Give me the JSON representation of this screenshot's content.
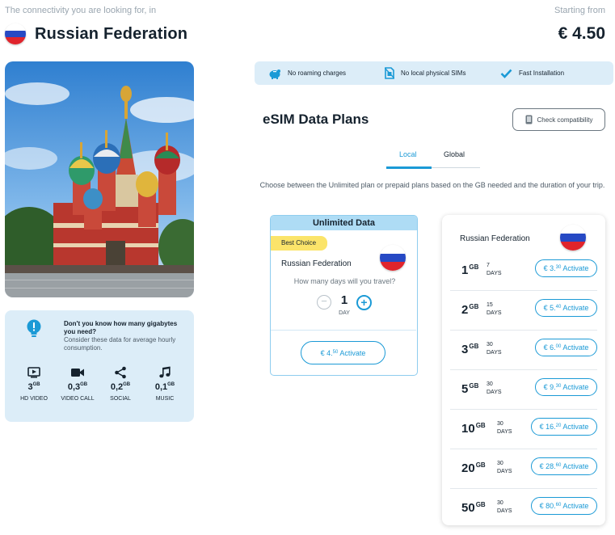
{
  "header": {
    "subtitle": "The connectivity you are looking for, in",
    "country": "Russian Federation",
    "starting_label": "Starting from",
    "starting_price": "€ 4.50"
  },
  "info": {
    "question": "Don't you know how many gigabytes you need?",
    "sub": "Consider these data for average hourly consumption.",
    "usages": [
      {
        "amount": "3",
        "unit": "GB",
        "label": "HD VIDEO",
        "icon": "hd-video-icon"
      },
      {
        "amount": "0,3",
        "unit": "GB",
        "label": "VIDEO CALL",
        "icon": "video-call-icon"
      },
      {
        "amount": "0,2",
        "unit": "GB",
        "label": "SOCIAL",
        "icon": "share-icon"
      },
      {
        "amount": "0,1",
        "unit": "GB",
        "label": "MUSIC",
        "icon": "music-icon"
      }
    ]
  },
  "features": [
    "No roaming charges",
    "No local physical SIMs",
    "Fast Installation"
  ],
  "plans": {
    "title": "eSIM Data Plans",
    "check_button": "Check compatibility",
    "tabs": [
      "Local",
      "Global"
    ],
    "active_tab": "Local",
    "description": "Choose between the Unlimited plan or prepaid plans based on the GB needed and the duration of your trip."
  },
  "unlimited": {
    "header": "Unlimited Data",
    "badge": "Best Choice",
    "country": "Russian Federation",
    "question": "How many days will you travel?",
    "days": "1",
    "day_label": "DAY",
    "price_main": "€ 4.",
    "price_cents": "50",
    "activate": " Activate"
  },
  "prepaid": {
    "country": "Russian Federation",
    "activate": " Activate",
    "items": [
      {
        "gb": "1",
        "unit": "GB",
        "days": "7",
        "days_label": "DAYS",
        "price_main": "€ 3.",
        "price_cents": "30"
      },
      {
        "gb": "2",
        "unit": "GB",
        "days": "15",
        "days_label": "DAYS",
        "price_main": "€ 5.",
        "price_cents": "40"
      },
      {
        "gb": "3",
        "unit": "GB",
        "days": "30",
        "days_label": "DAYS",
        "price_main": "€ 6.",
        "price_cents": "00"
      },
      {
        "gb": "5",
        "unit": "GB",
        "days": "30",
        "days_label": "DAYS",
        "price_main": "€ 9.",
        "price_cents": "30"
      },
      {
        "gb": "10",
        "unit": "GB",
        "days": "30",
        "days_label": "DAYS",
        "price_main": "€ 16.",
        "price_cents": "20"
      },
      {
        "gb": "20",
        "unit": "GB",
        "days": "30",
        "days_label": "DAYS",
        "price_main": "€ 28.",
        "price_cents": "60"
      },
      {
        "gb": "50",
        "unit": "GB",
        "days": "30",
        "days_label": "DAYS",
        "price_main": "€ 80.",
        "price_cents": "60"
      }
    ]
  },
  "colors": {
    "accent": "#1b9ad6",
    "light_blue": "#dcedf8",
    "badge_yellow": "#fbe46a",
    "text_dark": "#15222e"
  }
}
